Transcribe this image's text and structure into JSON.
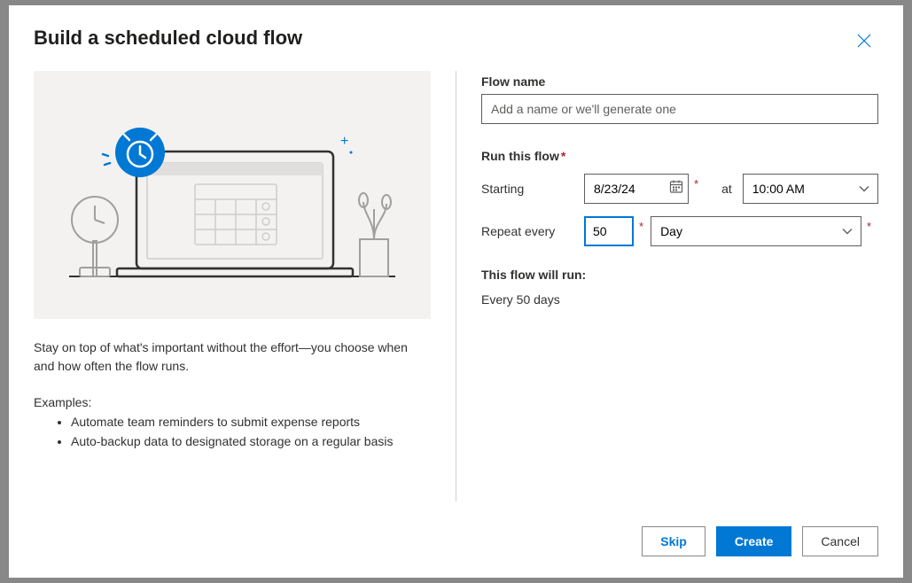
{
  "modal": {
    "title": "Build a scheduled cloud flow"
  },
  "left": {
    "description": "Stay on top of what's important without the effort—you choose when and how often the flow runs.",
    "examples_label": "Examples:",
    "examples": [
      "Automate team reminders to submit expense reports",
      "Auto-backup data to designated storage on a regular basis"
    ]
  },
  "form": {
    "flow_name_label": "Flow name",
    "flow_name_placeholder": "Add a name or we'll generate one",
    "run_label": "Run this flow",
    "starting_label": "Starting",
    "starting_value": "8/23/24",
    "at_label": "at",
    "time_value": "10:00 AM",
    "repeat_label": "Repeat every",
    "repeat_value": "50",
    "repeat_unit": "Day",
    "summary_label": "This flow will run:",
    "summary_value": "Every 50 days"
  },
  "footer": {
    "skip": "Skip",
    "create": "Create",
    "cancel": "Cancel"
  }
}
